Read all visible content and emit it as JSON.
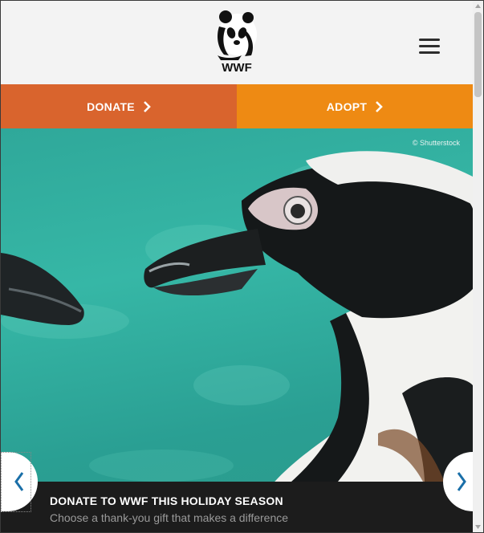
{
  "header": {
    "logo_text": "WWF",
    "menu_icon": "hamburger-menu-icon"
  },
  "cta": {
    "donate_label": "DONATE",
    "adopt_label": "ADOPT",
    "donate_color": "#d9642d",
    "adopt_color": "#ee8a13",
    "chevron_icon": "chevron-right-icon"
  },
  "hero": {
    "credit": "© Shutterstock",
    "caption_title": "DONATE TO WWF THIS HOLIDAY SEASON",
    "caption_subtitle": "Choose a thank-you gift that makes a difference",
    "prev_icon": "chevron-left-icon",
    "next_icon": "chevron-right-icon",
    "accent_color": "#1a6fa8"
  }
}
